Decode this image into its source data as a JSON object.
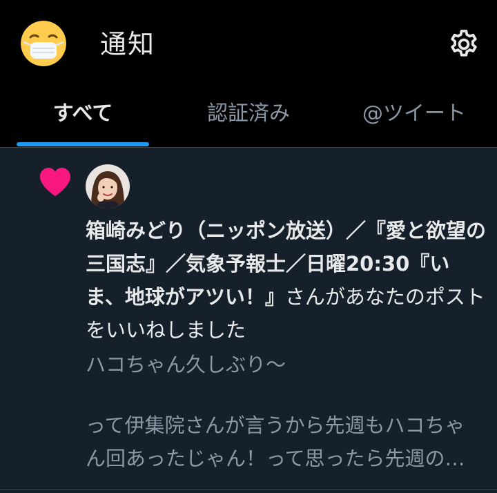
{
  "header": {
    "title": "通知",
    "avatar_icon": "mask-emoji-icon",
    "settings_icon": "gear-icon"
  },
  "tabs": [
    {
      "label": "すべて",
      "active": true
    },
    {
      "label": "認証済み",
      "active": false
    },
    {
      "label": "@ツイート",
      "active": false
    }
  ],
  "notification": {
    "type_icon": "heart-icon",
    "type_color": "#f91880",
    "user_name": "箱崎みどり（ニッポン放送）／『愛と欲望の三国志』／気象予報士／日曜20:30『いま、地球がアツい！』",
    "action_text": "さんがあなたのポストをいいねしました",
    "tweet_line1": "ハコちゃん久しぶり〜",
    "tweet_rest": "って伊集院さんが言うから先週もハコちゃん回あったじゃん！って思ったら先週の…"
  },
  "colors": {
    "background": "#15202b",
    "header_bg": "#000000",
    "accent": "#1d9bf0",
    "text_primary": "#e7e9ea",
    "text_secondary": "#8b98a5"
  }
}
